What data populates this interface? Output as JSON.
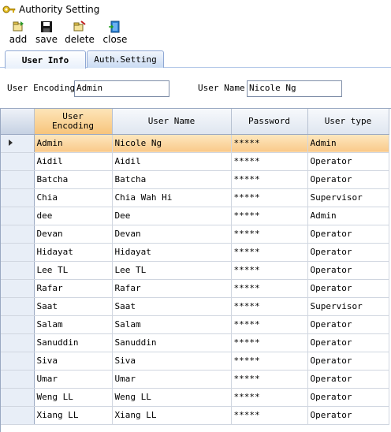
{
  "window": {
    "title": "Authority Setting"
  },
  "toolbar": {
    "add_label": "add",
    "save_label": "save",
    "delete_label": "delete",
    "close_label": "close"
  },
  "tabs": [
    {
      "label": "User Info",
      "active": true
    },
    {
      "label": "Auth.Setting",
      "active": false
    }
  ],
  "form": {
    "encoding_label": "User Encoding",
    "encoding_value": "Admin",
    "name_label": "User Name",
    "name_value": "Nicole Ng"
  },
  "grid": {
    "columns": [
      "User Encoding",
      "User Name",
      "Password",
      "User type"
    ],
    "selected_row": 0,
    "rows": [
      {
        "encoding": "Admin",
        "name": "Nicole Ng",
        "password": "*****",
        "type": "Admin"
      },
      {
        "encoding": "Aidil",
        "name": "Aidil",
        "password": "*****",
        "type": "Operator"
      },
      {
        "encoding": "Batcha",
        "name": "Batcha",
        "password": "*****",
        "type": "Operator"
      },
      {
        "encoding": "Chia",
        "name": "Chia Wah Hi",
        "password": "*****",
        "type": "Supervisor"
      },
      {
        "encoding": "dee",
        "name": "Dee",
        "password": "*****",
        "type": "Admin"
      },
      {
        "encoding": "Devan",
        "name": "Devan",
        "password": "*****",
        "type": "Operator"
      },
      {
        "encoding": "Hidayat",
        "name": "Hidayat",
        "password": "*****",
        "type": "Operator"
      },
      {
        "encoding": "Lee TL",
        "name": "Lee TL",
        "password": "*****",
        "type": "Operator"
      },
      {
        "encoding": "Rafar",
        "name": "Rafar",
        "password": "*****",
        "type": "Operator"
      },
      {
        "encoding": "Saat",
        "name": "Saat",
        "password": "*****",
        "type": "Supervisor"
      },
      {
        "encoding": "Salam",
        "name": "Salam",
        "password": "*****",
        "type": "Operator"
      },
      {
        "encoding": "Sanuddin",
        "name": "Sanuddin",
        "password": "*****",
        "type": "Operator"
      },
      {
        "encoding": "Siva",
        "name": "Siva",
        "password": "*****",
        "type": "Operator"
      },
      {
        "encoding": "Umar",
        "name": "Umar",
        "password": "*****",
        "type": "Operator"
      },
      {
        "encoding": "Weng LL",
        "name": "Weng LL",
        "password": "*****",
        "type": "Operator"
      },
      {
        "encoding": "Xiang LL",
        "name": "Xiang LL",
        "password": "*****",
        "type": "Operator"
      }
    ]
  },
  "icons": {
    "app": "key-icon",
    "add": "add-document-icon",
    "save": "floppy-disk-icon",
    "delete": "delete-document-icon",
    "close": "exit-door-icon"
  },
  "colors": {
    "selected_row": "#f9c98a",
    "sorted_header": "#f7c57c",
    "tab_border": "#8fa8d4"
  }
}
